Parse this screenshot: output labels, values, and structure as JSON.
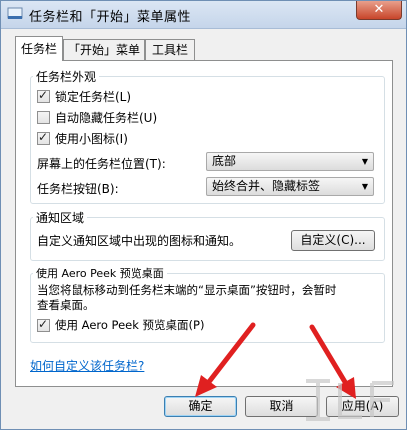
{
  "window": {
    "title": "任务栏和「开始」菜单属性",
    "close_label": "✕"
  },
  "tabs": [
    {
      "label": "任务栏",
      "active": true
    },
    {
      "label": "「开始」菜单",
      "active": false
    },
    {
      "label": "工具栏",
      "active": false
    }
  ],
  "appearance": {
    "title": "任务栏外观",
    "lock_taskbar": {
      "label": "锁定任务栏(L)",
      "checked": true
    },
    "auto_hide": {
      "label": "自动隐藏任务栏(U)",
      "checked": false
    },
    "small_icons": {
      "label": "使用小图标(I)",
      "checked": true
    },
    "position_label": "屏幕上的任务栏位置(T):",
    "position_value": "底部",
    "buttons_label": "任务栏按钮(B):",
    "buttons_value": "始终合并、隐藏标签"
  },
  "notification": {
    "title": "通知区域",
    "description": "自定义通知区域中出现的图标和通知。",
    "customize_button": "自定义(C)..."
  },
  "aero_peek": {
    "title": "使用 Aero Peek 预览桌面",
    "description_line1": "当您将鼠标移动到任务栏末端的“显示桌面”按钮时，会暂时",
    "description_line2": "查看桌面。",
    "checkbox": {
      "label": "使用 Aero Peek 预览桌面(P)",
      "checked": true
    }
  },
  "help_link": "如何自定义该任务栏?",
  "footer": {
    "ok": "确定",
    "cancel": "取消",
    "apply": "应用(A)"
  },
  "colors": {
    "annotation_arrow": "#e02020",
    "link": "#0066cc"
  }
}
